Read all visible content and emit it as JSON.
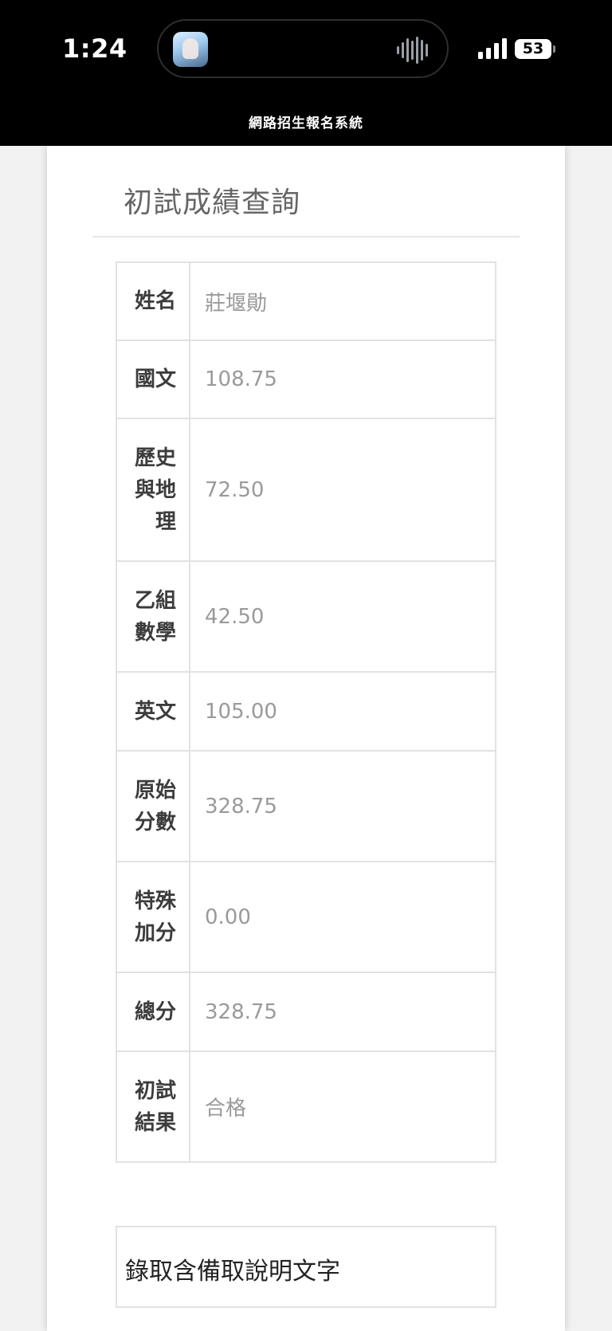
{
  "status_bar": {
    "time": "1:24",
    "battery": "53",
    "app_icon": "anime-avatar-icon",
    "waveform_icon": "audio-waveform-icon",
    "signal_icon": "cellular-signal-icon"
  },
  "header": {
    "title": "網路招生報名系統"
  },
  "main": {
    "title": "初試成績查詢",
    "rows": [
      {
        "label": "姓名",
        "value": "莊堰勛"
      },
      {
        "label": "國文",
        "value": "108.75"
      },
      {
        "label": "歷史與地理",
        "value": "72.50"
      },
      {
        "label": "乙組數學",
        "value": "42.50"
      },
      {
        "label": "英文",
        "value": "105.00"
      },
      {
        "label": "原始分數",
        "value": "328.75"
      },
      {
        "label": "特殊加分",
        "value": "0.00"
      },
      {
        "label": "總分",
        "value": "328.75"
      },
      {
        "label": "初試結果",
        "value": "合格"
      }
    ],
    "note": "錄取含備取說明文字"
  }
}
